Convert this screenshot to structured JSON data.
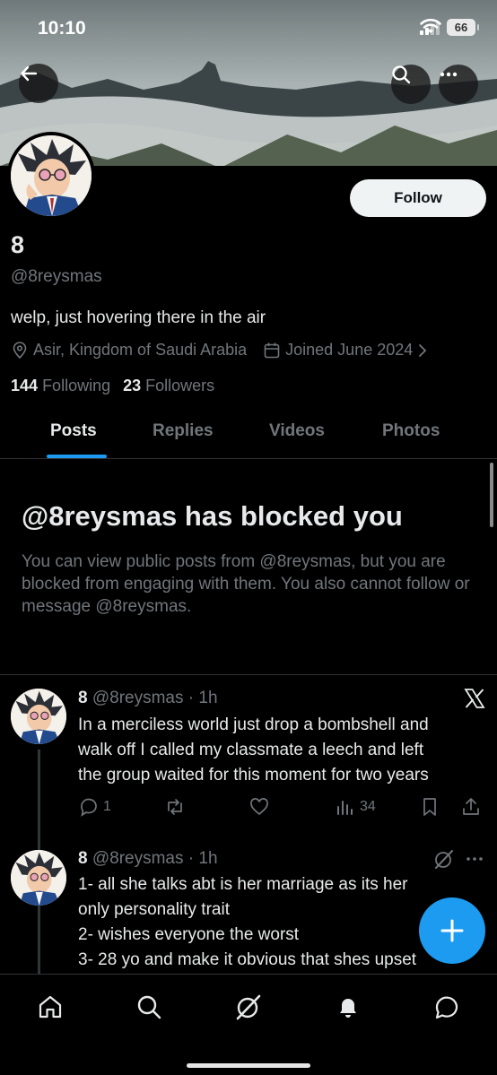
{
  "status_bar": {
    "time": "10:10",
    "battery": "66"
  },
  "profile": {
    "display_name": "8",
    "handle": "@8reysmas",
    "follow_label": "Follow",
    "bio": "welp, just hovering there in the air",
    "location": "Asir, Kingdom of Saudi Arabia",
    "joined": "Joined June 2024",
    "following_count": "144",
    "following_label": "Following",
    "followers_count": "23",
    "followers_label": "Followers"
  },
  "tabs": [
    {
      "label": "Posts",
      "active": true
    },
    {
      "label": "Replies",
      "active": false
    },
    {
      "label": "Videos",
      "active": false
    },
    {
      "label": "Photos",
      "active": false
    }
  ],
  "blocked": {
    "title": "@8reysmas has blocked you",
    "body": "You can view public posts from @8reysmas, but you are blocked from engaging with them. You also cannot follow or message @8reysmas."
  },
  "posts": [
    {
      "name": "8",
      "handle": "@8reysmas",
      "time": "· 1h",
      "text_lines": [
        "In a merciless world just drop a bombshell and",
        "walk off  I called my classmate a leech and left",
        "the group waited for this moment for two years"
      ],
      "replies": "1",
      "views": "34"
    },
    {
      "name": "8",
      "handle": "@8reysmas",
      "time": "· 1h",
      "text_lines": [
        "1- all she talks abt is her marriage as its her",
        "only personality trait",
        "2- wishes everyone the worst",
        "3- 28 yo and make it obvious that shes upset"
      ]
    }
  ],
  "colors": {
    "accent": "#1d9bf0",
    "muted": "#71767b",
    "text": "#e7e9ea",
    "border": "#2f3336"
  },
  "icons": {
    "back": "arrow-left-icon",
    "search": "search-icon",
    "more": "more-horizontal-icon",
    "location": "location-pin-icon",
    "calendar": "calendar-icon",
    "x_logo": "x-logo-icon",
    "grok": "grok-icon",
    "compose": "plus-icon"
  }
}
